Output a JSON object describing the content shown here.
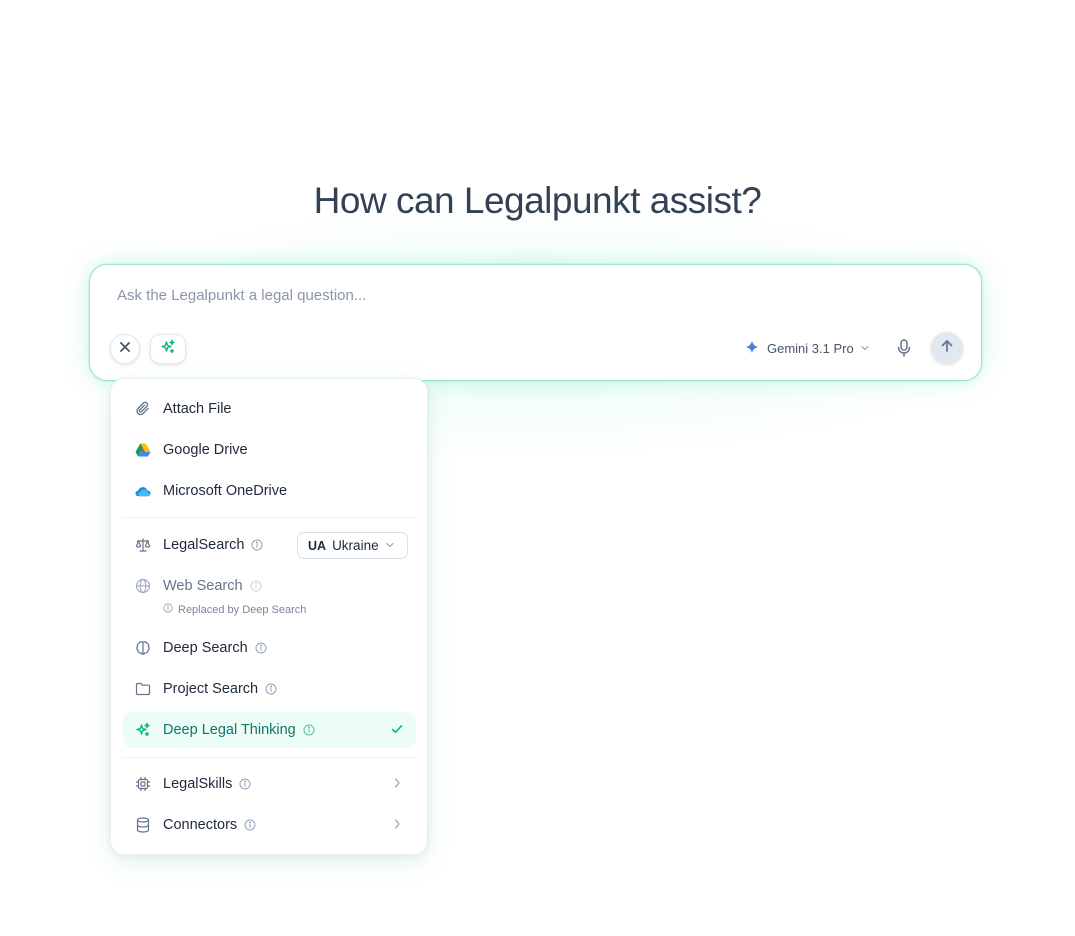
{
  "heading": "How can Legalpunkt assist?",
  "composer": {
    "placeholder": "Ask the Legalpunkt a legal question...",
    "model": "Gemini 3.1 Pro"
  },
  "menu": {
    "attach_file": "Attach File",
    "google_drive": "Google Drive",
    "onedrive": "Microsoft OneDrive",
    "legalsearch": "LegalSearch",
    "country_code": "UA",
    "country_name": "Ukraine",
    "web_search": "Web Search",
    "web_search_note": "Replaced by Deep Search",
    "deep_search": "Deep Search",
    "project_search": "Project Search",
    "deep_legal_thinking": "Deep Legal Thinking",
    "legalskills": "LegalSkills",
    "connectors": "Connectors"
  },
  "colors": {
    "accent": "#10b981",
    "active_bg": "#ecfdf5",
    "active_text": "#0f766e",
    "model_star": "#4f7be0"
  }
}
